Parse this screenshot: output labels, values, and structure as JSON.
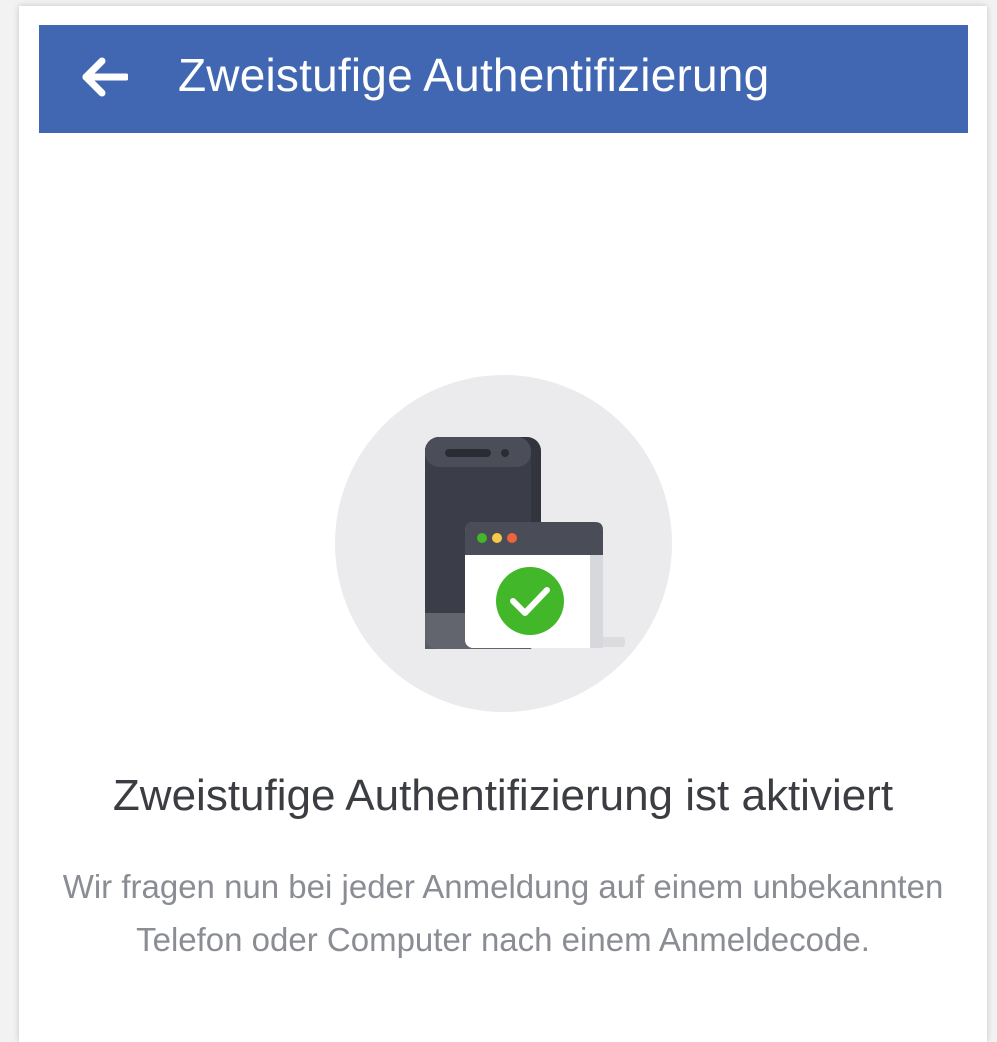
{
  "header": {
    "title": "Zweistufige Authentifizierung",
    "back_icon": "arrow-left-icon",
    "background_color": "#4267b2"
  },
  "illustration": {
    "icon": "phone-and-browser-check-icon",
    "check_color": "#42b72a"
  },
  "main": {
    "headline": "Zweistufige Authentifizierung ist aktiviert",
    "description": "Wir fragen nun bei jeder Anmeldung auf einem unbekannten Telefon oder Computer nach einem Anmeldecode."
  }
}
